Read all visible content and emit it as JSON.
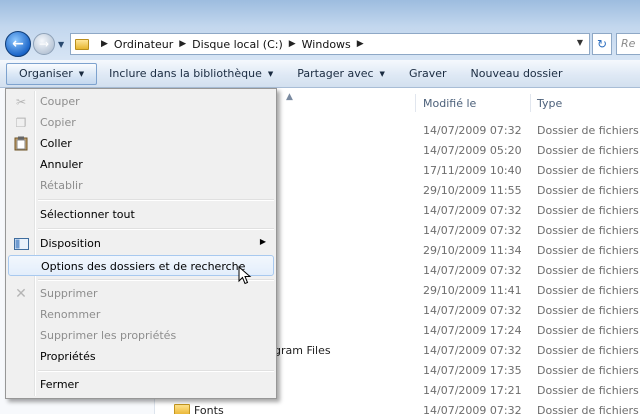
{
  "address": {
    "crumbs": [
      "Ordinateur",
      "Disque local (C:)",
      "Windows"
    ],
    "search_placeholder": "Re"
  },
  "command_bar": {
    "organize": "Organiser",
    "include_library": "Inclure dans la bibliothèque",
    "share_with": "Partager avec",
    "burn": "Graver",
    "new_folder": "Nouveau dossier"
  },
  "columns": {
    "modified": "Modifié le",
    "type": "Type"
  },
  "files": [
    {
      "date": "14/07/2009 07:32",
      "type": "Dossier de fichiers",
      "name": ""
    },
    {
      "date": "14/07/2009 05:20",
      "type": "Dossier de fichiers",
      "name": ""
    },
    {
      "date": "17/11/2009 10:40",
      "type": "Dossier de fichiers",
      "name": ""
    },
    {
      "date": "29/10/2009 11:55",
      "type": "Dossier de fichiers",
      "name": ""
    },
    {
      "date": "14/07/2009 07:32",
      "type": "Dossier de fichiers",
      "name": ""
    },
    {
      "date": "14/07/2009 07:32",
      "type": "Dossier de fichiers",
      "name": ""
    },
    {
      "date": "29/10/2009 11:34",
      "type": "Dossier de fichiers",
      "name": ""
    },
    {
      "date": "14/07/2009 07:32",
      "type": "Dossier de fichiers",
      "name": ""
    },
    {
      "date": "29/10/2009 11:41",
      "type": "Dossier de fichiers",
      "name": ""
    },
    {
      "date": "14/07/2009 07:32",
      "type": "Dossier de fichiers",
      "name": ""
    },
    {
      "date": "14/07/2009 17:24",
      "type": "Dossier de fichiers",
      "name": ""
    },
    {
      "date": "14/07/2009 07:32",
      "type": "Dossier de fichiers",
      "name": "gram Files"
    },
    {
      "date": "14/07/2009 17:35",
      "type": "Dossier de fichiers",
      "name": ""
    },
    {
      "date": "14/07/2009 17:21",
      "type": "Dossier de fichiers",
      "name": ""
    },
    {
      "date": "14/07/2009 07:32",
      "type": "Dossier de fichiers",
      "name": "Fonts"
    }
  ],
  "menu": {
    "cut": "Couper",
    "copy": "Copier",
    "paste": "Coller",
    "undo": "Annuler",
    "redo": "Rétablir",
    "select_all": "Sélectionner tout",
    "layout": "Disposition",
    "folder_options": "Options des dossiers et de recherche",
    "delete": "Supprimer",
    "rename": "Renommer",
    "remove_properties": "Supprimer les propriétés",
    "properties": "Propriétés",
    "close": "Fermer"
  }
}
